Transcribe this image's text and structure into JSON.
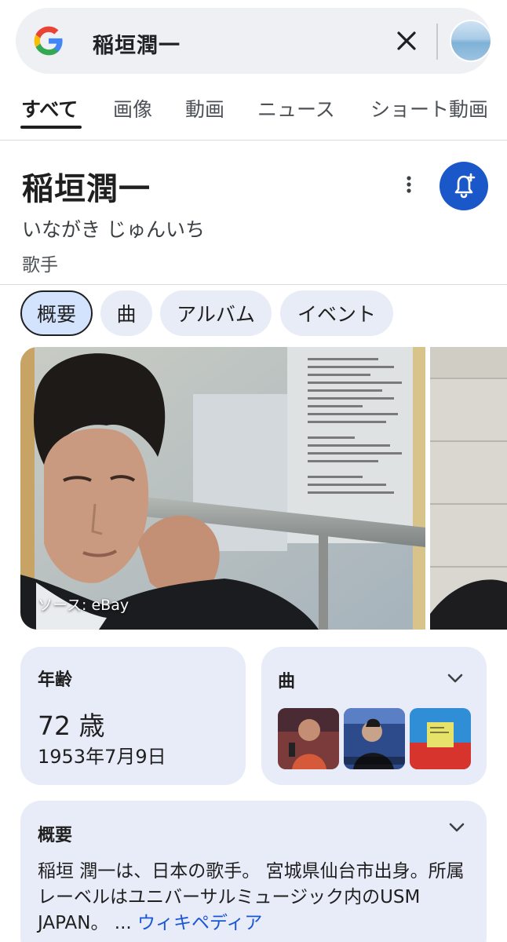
{
  "search": {
    "query": "稲垣潤一"
  },
  "tabs": [
    {
      "label": "すべて",
      "active": true
    },
    {
      "label": "画像"
    },
    {
      "label": "動画"
    },
    {
      "label": "ニュース"
    },
    {
      "label": "ショート動画"
    }
  ],
  "entity": {
    "title": "稲垣潤一",
    "reading": "いながき じゅんいち",
    "category": "歌手"
  },
  "chips": [
    {
      "label": "概要",
      "active": true
    },
    {
      "label": "曲"
    },
    {
      "label": "アルバム"
    },
    {
      "label": "イベント"
    }
  ],
  "image": {
    "source_label": "ソース: eBay"
  },
  "age_card": {
    "title": "年齢",
    "value": "72 歳",
    "birthdate": "1953年7月9日"
  },
  "songs_card": {
    "title": "曲"
  },
  "overview_card": {
    "title": "概要",
    "text": "稲垣 潤一は、日本の歌手。 宮城県仙台市出身。所属レーベルはユニバーサルミュージック内のUSM JAPAN。",
    "ellipsis": " ... ",
    "link_label": "ウィキペディア"
  },
  "colors": {
    "accent_blue": "#1a57c9",
    "card_bg": "#e8ecf8",
    "chip_active_bg": "#d3e3fd",
    "link": "#1a56d6"
  },
  "icons": [
    "google-logo-icon",
    "close-icon",
    "avatar",
    "more-vert-icon",
    "bell-add-icon",
    "chevron-down-icon"
  ]
}
